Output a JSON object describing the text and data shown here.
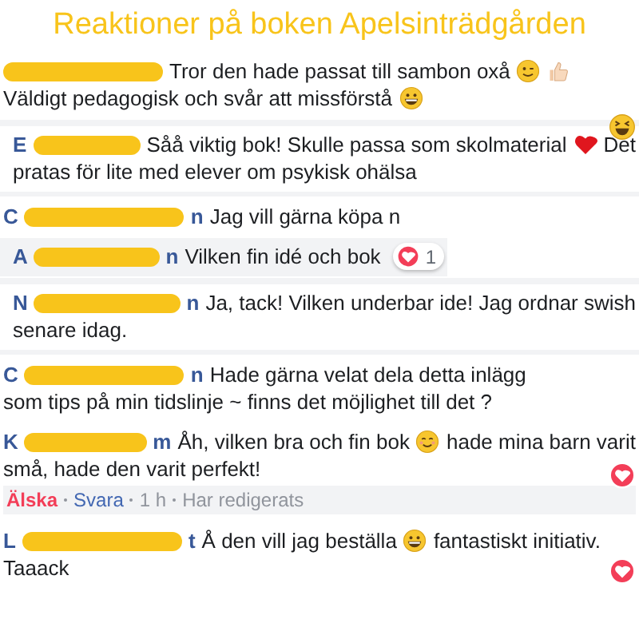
{
  "title": "Reaktioner på  boken Apelsinträdgården",
  "comments": [
    {
      "kind": "plain",
      "lines": [
        [
          {
            "kind": "text",
            "text": "Tror den hade passat till sambon oxå"
          },
          {
            "kind": "wink"
          },
          {
            "kind": "thumb"
          }
        ],
        [
          {
            "kind": "text",
            "text": "Väldigt pedagogisk och svår att missförstå"
          },
          {
            "kind": "grin"
          }
        ]
      ]
    },
    {
      "kind": "card",
      "name_start": "E",
      "reactions": [
        {
          "kind": "laugh"
        }
      ],
      "lines": [
        [
          {
            "kind": "text",
            "text": "Såå viktig bok! Skulle passa som skolmaterial"
          },
          {
            "kind": "heart"
          },
          {
            "kind": "text",
            "text": "Det"
          }
        ],
        [
          {
            "kind": "text",
            "text": "pratas för lite med elever om psykisk ohälsa"
          }
        ]
      ]
    },
    {
      "kind": "plain",
      "name_start": "C",
      "name_end": "n",
      "lines": [
        [
          {
            "kind": "text",
            "text": "Jag vill gärna köpa n"
          }
        ]
      ]
    },
    {
      "kind": "grey",
      "name_start": "A",
      "name_end": "n",
      "reactions": [
        {
          "kind": "love",
          "count": "1"
        }
      ],
      "lines": [
        [
          {
            "kind": "text",
            "text": "Vilken fin idé och bok"
          }
        ]
      ]
    },
    {
      "kind": "card",
      "name_start": "N",
      "name_end": "n",
      "lines": [
        [
          {
            "kind": "text",
            "text": "Ja, tack! Vilken underbar ide! Jag ordnar swish"
          }
        ],
        [
          {
            "kind": "text",
            "text": "senare idag."
          }
        ]
      ]
    },
    {
      "kind": "plain",
      "name_start": "C",
      "name_end": "n",
      "lines": [
        [
          {
            "kind": "text",
            "text": "Hade gärna velat dela detta inlägg"
          }
        ],
        [
          {
            "kind": "text",
            "text": "som tips på min tidslinje ~ finns det möjlighet till det ?"
          }
        ]
      ]
    },
    {
      "kind": "plain",
      "name_start": "K",
      "name_end": "m",
      "reactions": [
        {
          "kind": "love"
        }
      ],
      "actions": [
        {
          "kind": "love",
          "text": "Älska"
        },
        {
          "kind": "reply",
          "text": "Svara"
        },
        {
          "kind": "time",
          "text": "1 h"
        },
        {
          "kind": "edited",
          "text": "Har redigerats"
        }
      ],
      "lines": [
        [
          {
            "kind": "text",
            "text": "Åh, vilken bra och fin bok"
          },
          {
            "kind": "smile"
          },
          {
            "kind": "text",
            "text": "hade mina barn varit"
          }
        ],
        [
          {
            "kind": "text",
            "text": "små, hade den varit perfekt!"
          }
        ]
      ]
    },
    {
      "kind": "plain",
      "name_start": "L",
      "name_end": "t",
      "reactions": [
        {
          "kind": "love"
        }
      ],
      "lines": [
        [
          {
            "kind": "text",
            "text": "Å den vill jag beställa"
          },
          {
            "kind": "grin"
          },
          {
            "kind": "text",
            "text": "fantastiskt initiativ."
          }
        ],
        [
          {
            "kind": "text",
            "text": "Taaack"
          }
        ]
      ]
    }
  ]
}
